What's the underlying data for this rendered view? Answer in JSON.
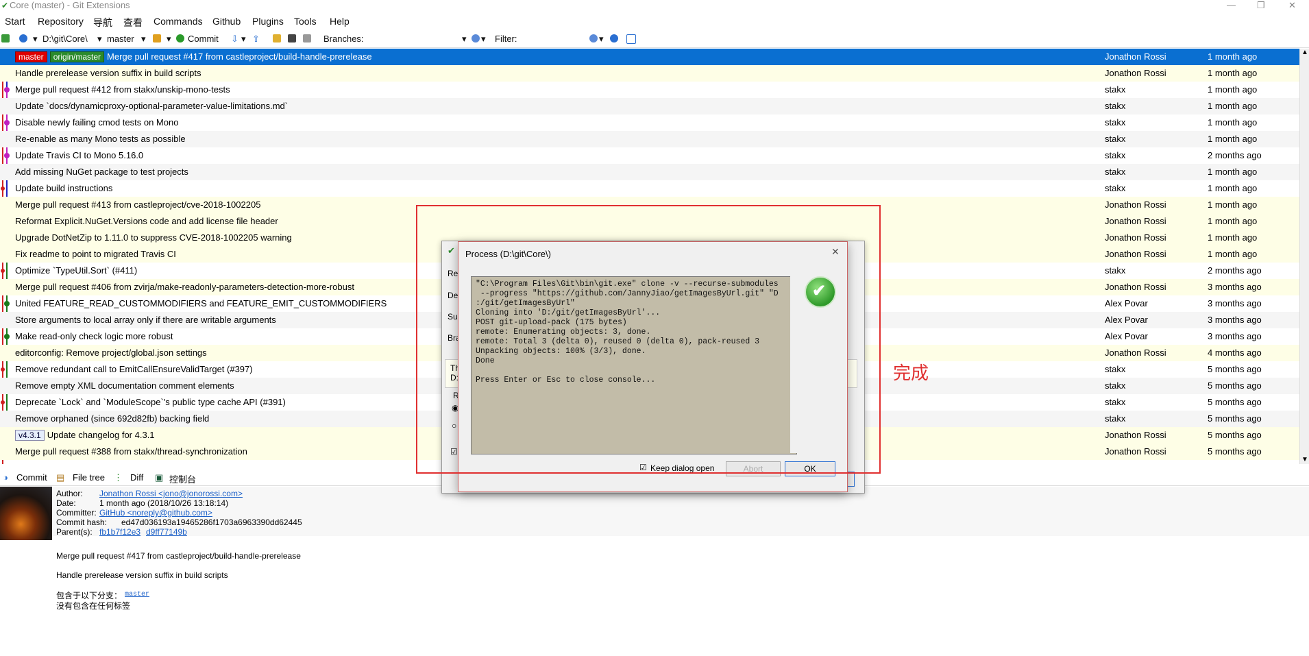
{
  "window": {
    "title": "Core (master) - Git Extensions"
  },
  "menu": {
    "items": [
      "Start",
      "Repository",
      "导航",
      "查看",
      "Commands",
      "Github",
      "Plugins",
      "Tools",
      "Help"
    ]
  },
  "toolbar": {
    "repo_path": "D:\\git\\Core\\",
    "branch": "master",
    "commit_label": "Commit",
    "branches_label": "Branches:",
    "filter_label": "Filter:"
  },
  "commits": [
    {
      "msg": "Merge pull request #417 from castleproject/build-handle-prerelease",
      "author": "Jonathon Rossi",
      "date": "1 month ago",
      "tags": [
        "master",
        "origin/master"
      ]
    },
    {
      "msg": "Handle prerelease version suffix in build scripts",
      "author": "Jonathon Rossi",
      "date": "1 month ago"
    },
    {
      "msg": "Merge pull request #412 from stakx/unskip-mono-tests",
      "author": "stakx",
      "date": "1 month ago"
    },
    {
      "msg": "Update `docs/dynamicproxy-optional-parameter-value-limitations.md`",
      "author": "stakx",
      "date": "1 month ago"
    },
    {
      "msg": "Disable newly failing cmod tests on Mono",
      "author": "stakx",
      "date": "1 month ago"
    },
    {
      "msg": "Re-enable as many Mono tests as possible",
      "author": "stakx",
      "date": "1 month ago"
    },
    {
      "msg": "Update Travis CI to Mono 5.16.0",
      "author": "stakx",
      "date": "2 months ago"
    },
    {
      "msg": "Add missing NuGet package to test projects",
      "author": "stakx",
      "date": "1 month ago"
    },
    {
      "msg": "Update build instructions",
      "author": "stakx",
      "date": "1 month ago"
    },
    {
      "msg": "Merge pull request #413 from castleproject/cve-2018-1002205",
      "author": "Jonathon Rossi",
      "date": "1 month ago"
    },
    {
      "msg": "Reformat Explicit.NuGet.Versions code and add license file header",
      "author": "Jonathon Rossi",
      "date": "1 month ago"
    },
    {
      "msg": "Upgrade DotNetZip to 1.11.0 to suppress CVE-2018-1002205 warning",
      "author": "Jonathon Rossi",
      "date": "1 month ago"
    },
    {
      "msg": "Fix readme to point to migrated Travis CI",
      "author": "Jonathon Rossi",
      "date": "1 month ago"
    },
    {
      "msg": "Optimize `TypeUtil.Sort` (#411)",
      "author": "stakx",
      "date": "2 months ago"
    },
    {
      "msg": "Merge pull request #406 from zvirja/make-readonly-parameters-detection-more-robust",
      "author": "Jonathon Rossi",
      "date": "3 months ago"
    },
    {
      "msg": "United FEATURE_READ_CUSTOMMODIFIERS and FEATURE_EMIT_CUSTOMMODIFIERS",
      "author": "Alex Povar",
      "date": "3 months ago"
    },
    {
      "msg": "Store arguments to local array only if there are writable arguments",
      "author": "Alex Povar",
      "date": "3 months ago"
    },
    {
      "msg": "Make read-only check logic more robust",
      "author": "Alex Povar",
      "date": "3 months ago"
    },
    {
      "msg": "editorconfig: Remove project/global.json settings",
      "author": "Jonathon Rossi",
      "date": "4 months ago"
    },
    {
      "msg": "Remove redundant call to EmitCallEnsureValidTarget (#397)",
      "author": "stakx",
      "date": "5 months ago"
    },
    {
      "msg": "Remove empty XML documentation comment elements",
      "author": "stakx",
      "date": "5 months ago"
    },
    {
      "msg": "Deprecate `Lock` and `ModuleScope`'s public type cache API (#391)",
      "author": "stakx",
      "date": "5 months ago"
    },
    {
      "msg": "Remove orphaned (since 692d82fb) backing field",
      "author": "stakx",
      "date": "5 months ago"
    },
    {
      "msg": "Update changelog for 4.3.1",
      "author": "Jonathon Rossi",
      "date": "5 months ago",
      "tags": [
        "v4.3.1"
      ]
    },
    {
      "msg": "Merge pull request #388 from stakx/thread-synchronization",
      "author": "Jonathon Rossi",
      "date": "5 months ago"
    }
  ],
  "tabs": [
    "Commit",
    "File tree",
    "Diff",
    "控制台"
  ],
  "commit_info": {
    "author_label": "Author:",
    "author": "Jonathon Rossi <jono@jonorossi.com>",
    "date_label": "Date:",
    "date": "1 month ago (2018/10/26 13:18:14)",
    "committer_label": "Committer:",
    "committer": "GitHub <noreply@github.com>",
    "hash_label": "Commit hash:",
    "hash": "ed47d036193a19465286f1703a6963390dd62445",
    "parents_label": "Parent(s):",
    "parent1": "fb1b7f12e3",
    "parent2": "d9ff77149b",
    "message1": "Merge pull request #417 from castleproject/build-handle-prerelease",
    "message2": "Handle prerelease version suffix in build scripts",
    "branches_label": "包含于以下分支：",
    "branch": "master",
    "tags_text": "没有包含在任何标签"
  },
  "clone_dialog": {
    "labels": [
      "Rep",
      "De",
      "Sul",
      "Bra",
      "Th",
      "D:",
      "R"
    ]
  },
  "process_dialog": {
    "title": "Process (D:\\git\\Core\\)",
    "console": "\"C:\\Program Files\\Git\\bin\\git.exe\" clone -v --recurse-submodules\n --progress \"https://github.com/JannyJiao/getImagesByUrl.git\" \"D\n:/git/getImagesByUrl\"\nCloning into 'D:/git/getImagesByUrl'...\nPOST git-upload-pack (175 bytes)\nremote: Enumerating objects: 3, done.\nremote: Total 3 (delta 0), reused 0 (delta 0), pack-reused 3\nUnpacking objects: 100% (3/3), done.\nDone\n\nPress Enter or Esc to close console...",
    "keep_open_label": "Keep dialog open",
    "abort_label": "Abort",
    "ok_label": "OK"
  },
  "annotation": {
    "text": "完成"
  }
}
